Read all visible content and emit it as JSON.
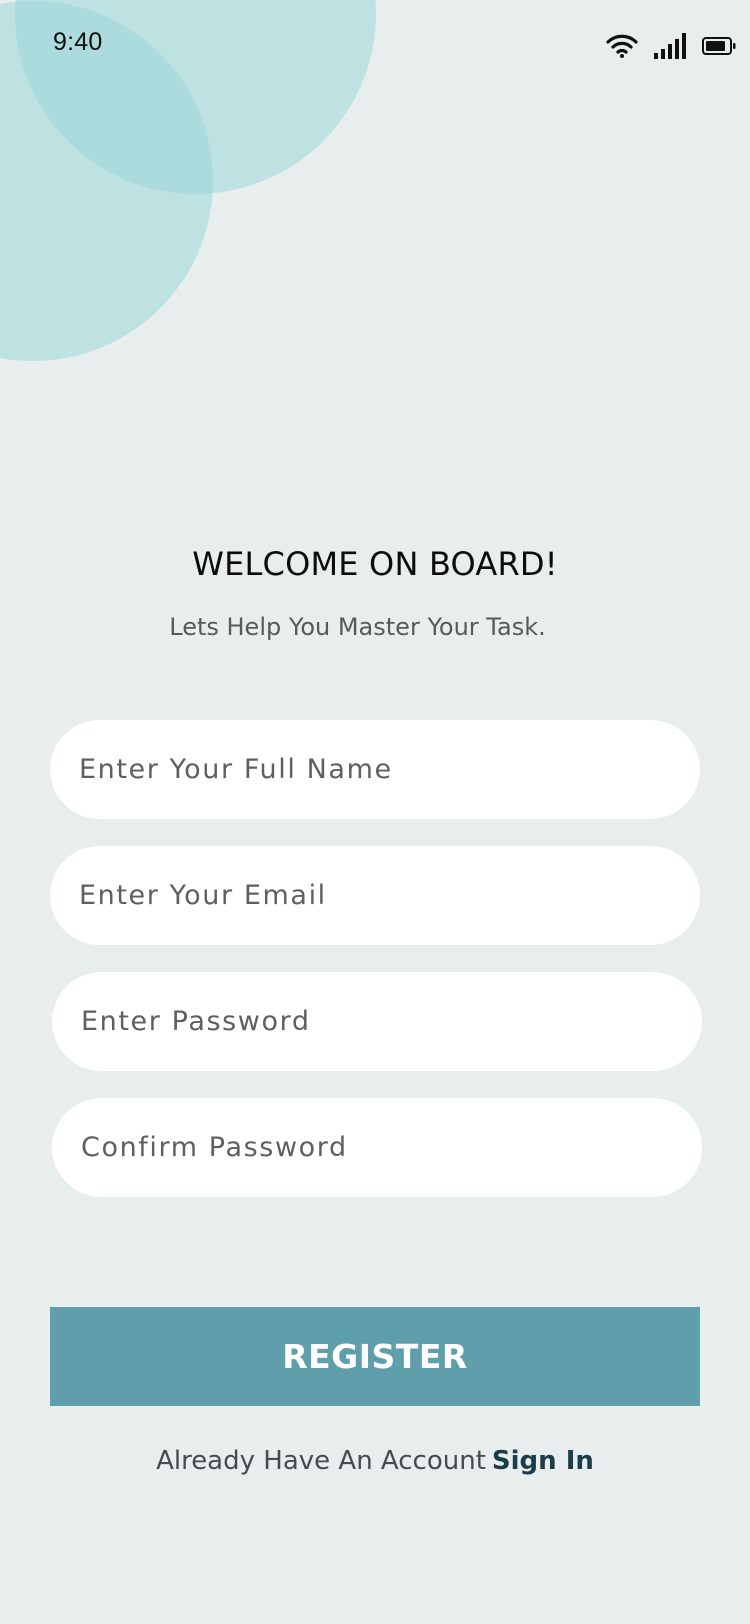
{
  "status_bar": {
    "time": "9:40",
    "icons": [
      "wifi-icon",
      "cellular-signal-icon",
      "battery-icon"
    ]
  },
  "header": {
    "title": "WELCOME ON BOARD!",
    "subtitle": "Lets Help You Master Your Task."
  },
  "form": {
    "full_name": {
      "placeholder": "Enter Your Full Name",
      "value": ""
    },
    "email": {
      "placeholder": "Enter Your Email",
      "value": ""
    },
    "password": {
      "placeholder": "Enter Password",
      "value": ""
    },
    "confirm_password": {
      "placeholder": "Confirm Password",
      "value": ""
    }
  },
  "register_button": {
    "label": "REGISTER"
  },
  "footer": {
    "prompt": "Already Have An Account",
    "link": "Sign In"
  },
  "colors": {
    "background": "#e8eeee",
    "decor_circle": "#9bd7d8",
    "accent_button": "#5f9eab",
    "link": "#1c3c49"
  }
}
